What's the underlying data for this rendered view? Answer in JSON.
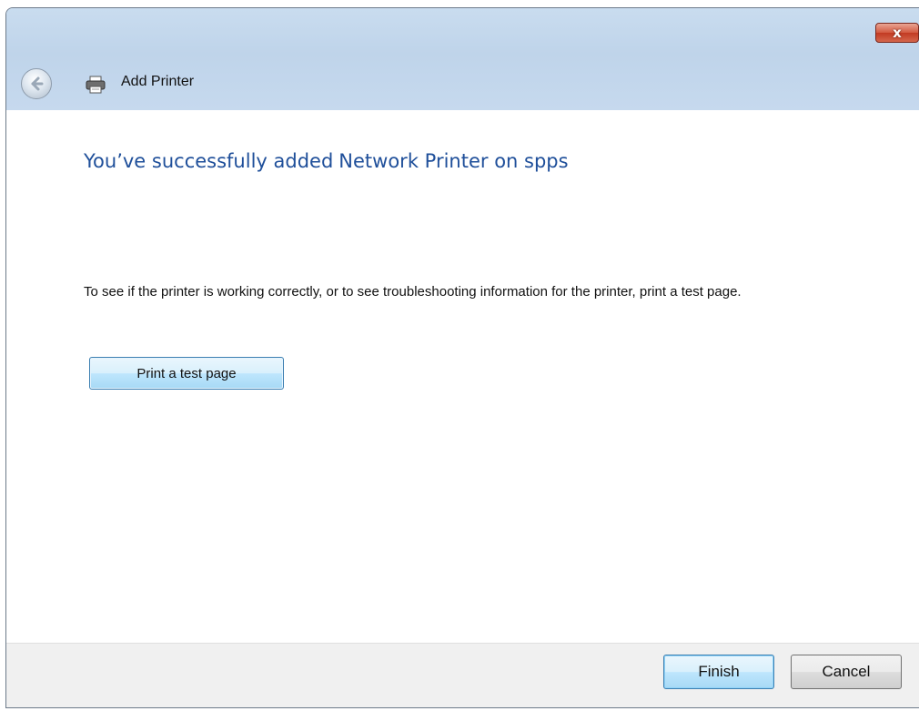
{
  "window": {
    "title": "Add Printer",
    "close_label": "x"
  },
  "content": {
    "headline_prefix": "You’ve successfully added",
    "printer_name": "Network Printer on spps",
    "info": "To see if the printer is working correctly, or to see troubleshooting information for the printer, print a test page.",
    "test_page_button": "Print a test page"
  },
  "footer": {
    "finish_label": "Finish",
    "cancel_label": "Cancel"
  },
  "colors": {
    "headline": "#1f4f9a",
    "titlebar": "#c6d9ee",
    "close": "#c23a22",
    "focused_button": "#3c7fb1"
  },
  "icons": {
    "back": "back-arrow-icon",
    "printer": "printer-icon",
    "close": "close-icon"
  }
}
